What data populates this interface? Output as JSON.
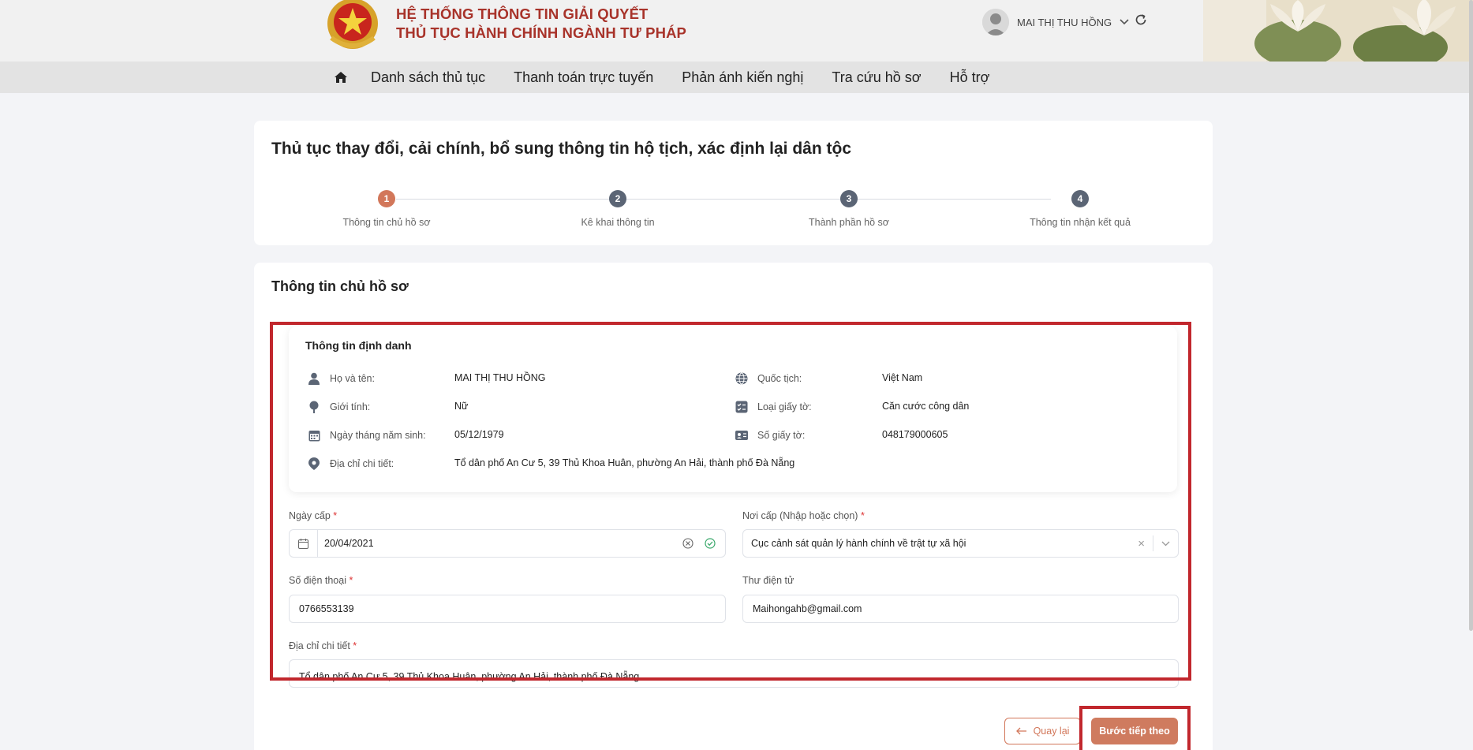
{
  "header": {
    "system_title_line1": "HỆ THỐNG THÔNG TIN GIẢI QUYẾT",
    "system_title_line2": "THỦ TỤC HÀNH CHÍNH NGÀNH TƯ PHÁP",
    "user_name": "MAI THỊ THU HỒNG"
  },
  "nav": {
    "items": [
      "Danh sách thủ tục",
      "Thanh toán trực tuyến",
      "Phản ánh kiến nghị",
      "Tra cứu hồ sơ",
      "Hỗ trợ"
    ]
  },
  "procedure": {
    "title": "Thủ tục thay đổi, cải chính, bổ sung thông tin hộ tịch, xác định lại dân tộc",
    "steps": [
      {
        "num": "1",
        "label": "Thông tin chủ hồ sơ",
        "active": true
      },
      {
        "num": "2",
        "label": "Kê khai thông tin",
        "active": false
      },
      {
        "num": "3",
        "label": "Thành phần hồ sơ",
        "active": false
      },
      {
        "num": "4",
        "label": "Thông tin nhận kết quả",
        "active": false
      }
    ]
  },
  "section": {
    "title": "Thông tin chủ hồ sơ",
    "identity": {
      "title": "Thông tin định danh",
      "full_name_label": "Họ và tên:",
      "full_name": "MAI THỊ THU HỒNG",
      "gender_label": "Giới tính:",
      "gender": "Nữ",
      "dob_label": "Ngày tháng năm sinh:",
      "dob": "05/12/1979",
      "address_label": "Địa chỉ chi tiết:",
      "address": "Tổ dân phố An Cư 5, 39 Thủ Khoa Huân, phường An Hải, thành phố Đà Nẵng",
      "nationality_label": "Quốc tịch:",
      "nationality": "Việt Nam",
      "doc_type_label": "Loại giấy tờ:",
      "doc_type": "Căn cước công dân",
      "doc_number_label": "Số giấy tờ:",
      "doc_number": "048179000605"
    },
    "form": {
      "issue_date_label": "Ngày cấp",
      "issue_date": "20/04/2021",
      "issue_place_label": "Nơi cấp (Nhập hoặc chọn)",
      "issue_place": "Cục cảnh sát quản lý hành chính về trật tự xã hội",
      "phone_label": "Số điện thoại",
      "phone": "0766553139",
      "email_label": "Thư điện tử",
      "email": "Maihongahb@gmail.com",
      "address_label": "Địa chỉ chi tiết",
      "address": "Tổ dân phố An Cư 5, 39 Thủ Khoa Huân, phường An Hải, thành phố Đà Nẵng",
      "required_mark": "*"
    },
    "buttons": {
      "back": "Quay lại",
      "next": "Bước tiếp theo"
    }
  },
  "colors": {
    "brand_red": "#a8332a",
    "accent": "#cf7b5f",
    "highlight_box": "#c1272d"
  }
}
